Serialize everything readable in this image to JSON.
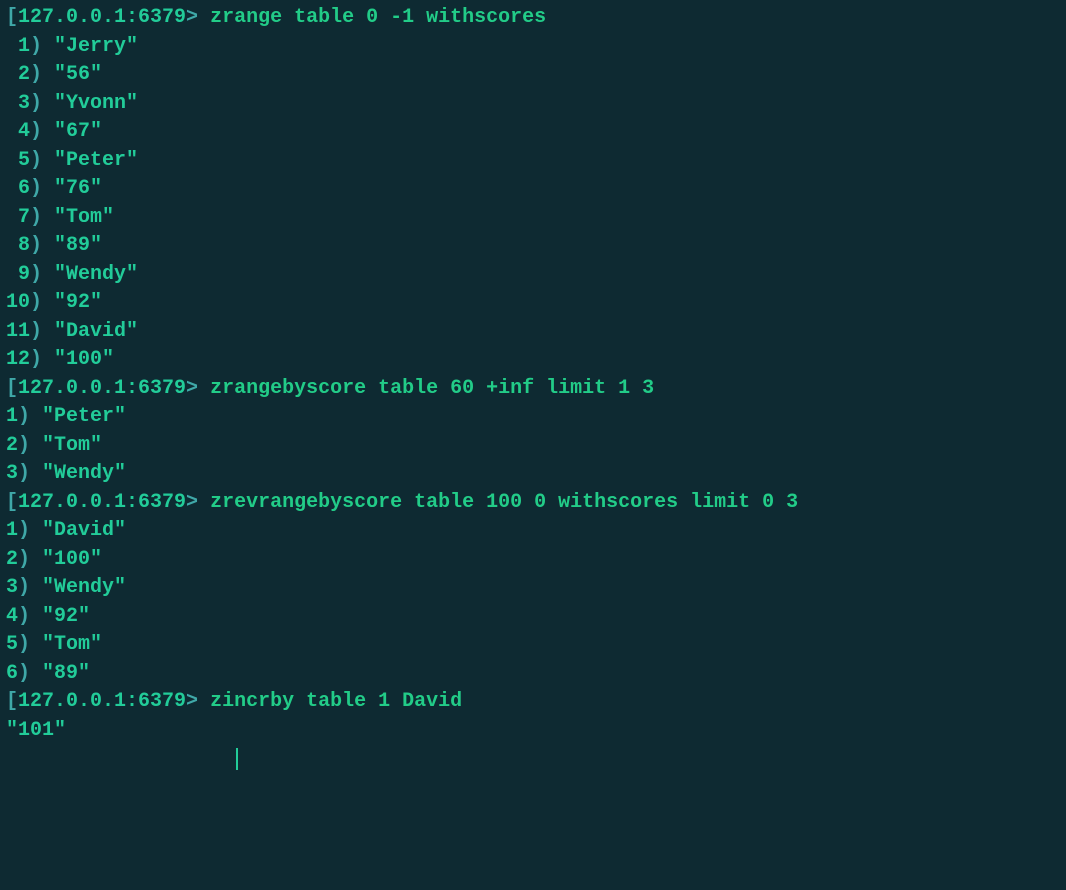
{
  "prompt_host": "127.0.0.1:6379",
  "prompt_suffix": "> ",
  "blocks": [
    {
      "command": "zrange table 0 -1 withscores",
      "idx_width": 2,
      "results": [
        "Jerry",
        "56",
        "Yvonn",
        "67",
        "Peter",
        "76",
        "Tom",
        "89",
        "Wendy",
        "92",
        "David",
        "100"
      ]
    },
    {
      "command": "zrangebyscore table 60 +inf limit 1 3",
      "idx_width": 1,
      "results": [
        "Peter",
        "Tom",
        "Wendy"
      ]
    },
    {
      "command": "zrevrangebyscore table 100 0 withscores limit 0 3",
      "idx_width": 1,
      "results": [
        "David",
        "100",
        "Wendy",
        "92",
        "Tom",
        "89"
      ]
    },
    {
      "command": "zincrby table 1 David",
      "raw_result": "101"
    }
  ]
}
